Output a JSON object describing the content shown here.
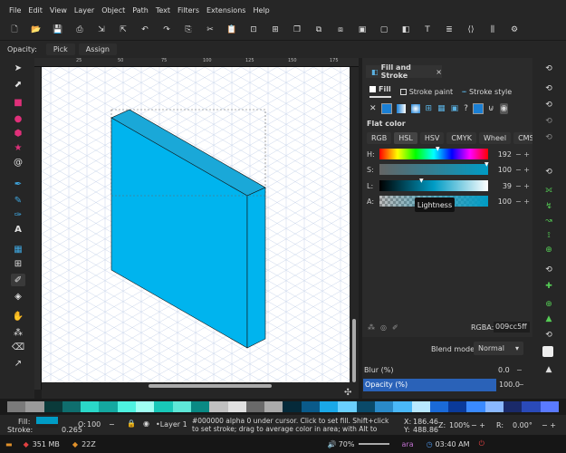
{
  "menu": [
    "File",
    "Edit",
    "View",
    "Layer",
    "Object",
    "Path",
    "Text",
    "Filters",
    "Extensions",
    "Help"
  ],
  "toolcontrols": {
    "opacity_label": "Opacity:",
    "pick": "Pick",
    "assign": "Assign"
  },
  "ruler_ticks": [
    "25",
    "50",
    "75",
    "100",
    "125",
    "150",
    "175"
  ],
  "dialog": {
    "title": "Fill and Stroke",
    "close": "×",
    "tabs": [
      "Fill",
      "Stroke paint",
      "Stroke style"
    ],
    "paint_label": "Flat color",
    "modes": [
      "RGB",
      "HSL",
      "HSV",
      "CMYK",
      "Wheel",
      "CMS"
    ],
    "sliders": [
      {
        "label": "H:",
        "value": "192"
      },
      {
        "label": "S:",
        "value": "100"
      },
      {
        "label": "L:",
        "value": "39"
      },
      {
        "label": "A:",
        "value": "100"
      }
    ],
    "tooltip": "Lightness",
    "rgba_label": "RGBA:",
    "rgba_value": "009cc5ff",
    "blend_label": "Blend mode:",
    "blend_value": "Normal",
    "blur_label": "Blur (%)",
    "blur_value": "0.0",
    "opacity_label": "Opacity (%)",
    "opacity_value": "100.0"
  },
  "status": {
    "fill_label": "Fill:",
    "stroke_label": "Stroke:",
    "stroke_width": "0.265",
    "opacity_label": "O:",
    "opacity_value": "100",
    "layer": "•Layer 1",
    "message": "#000000 alpha 0 under cursor. Click to set fill. Shift+click to set stroke; drag to average color in area; with Alt to pick inverse color;...",
    "x_label": "X:",
    "x_value": "186.46",
    "y_label": "Y:",
    "y_value": "488.86",
    "zoom_label": "Z:",
    "zoom_value": "100%",
    "rot_label": "R:",
    "rot_value": "0.00°"
  },
  "taskbar": {
    "memory": "351 MB",
    "count": "22Z",
    "volume": "70%",
    "user": "ara",
    "time": "03:40 AM"
  },
  "colors": {
    "accent": "#009cc5",
    "shape_front": "#00b4ee",
    "shape_top": "#1aa8d8",
    "shape_side": "#00b4ee",
    "panel_highlight": "#2a62b8"
  }
}
